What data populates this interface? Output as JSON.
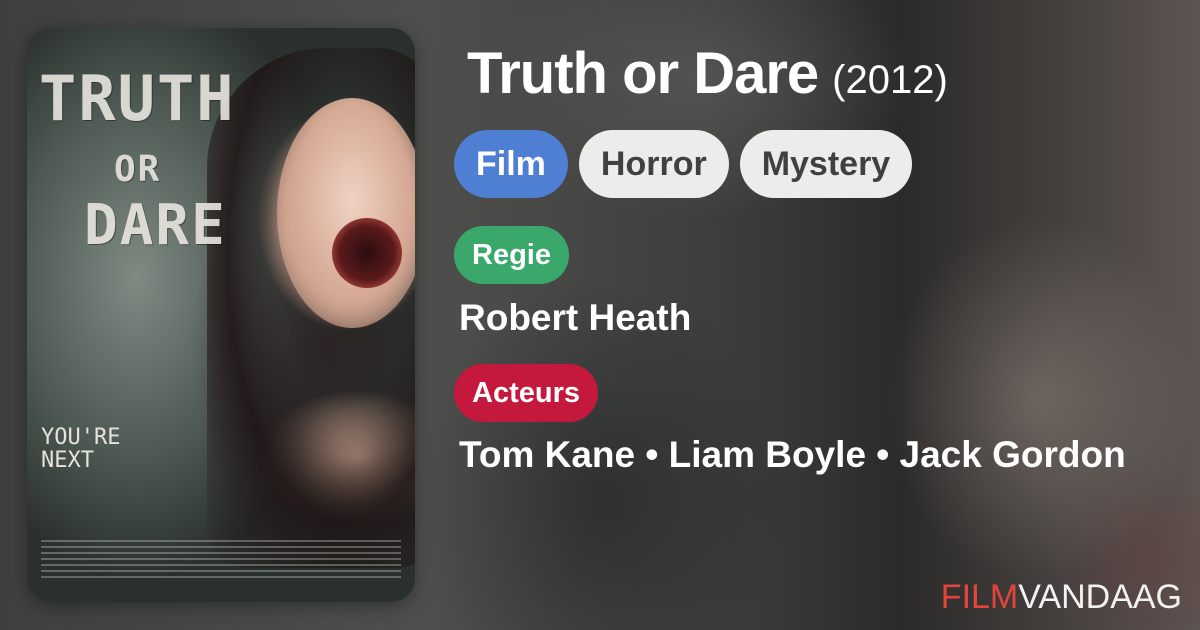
{
  "poster": {
    "title_lines": [
      "TRUTH",
      "OR",
      "DARE"
    ],
    "tagline": "YOU'RE NEXT"
  },
  "movie": {
    "title": "Truth or Dare",
    "year": "(2012)"
  },
  "tags": [
    "Film",
    "Horror",
    "Mystery"
  ],
  "director": {
    "label": "Regie",
    "value": "Robert Heath"
  },
  "cast": {
    "label": "Acteurs",
    "value": "Tom Kane • Liam Boyle • Jack Gordon"
  },
  "brand": {
    "part1": "FILM",
    "part2": "VANDAAG"
  },
  "colors": {
    "tag_primary": "#4e7fd2",
    "tag_secondary": "#ececec",
    "regie": "#3aa86a",
    "acteurs": "#c4183c",
    "brand_accent": "#e4443a"
  }
}
